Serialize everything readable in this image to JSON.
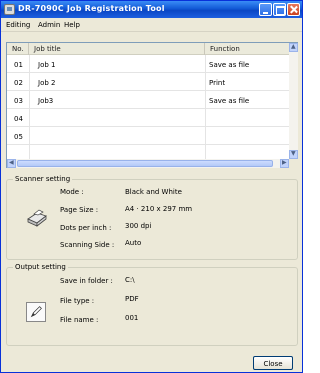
{
  "window": {
    "title": "DR-7090C Job Registration Tool"
  },
  "menu": {
    "items": [
      "Editing",
      "Admin",
      "Help"
    ]
  },
  "list": {
    "columns": [
      "No.",
      "Job title",
      "Function"
    ],
    "rows": [
      {
        "no": "01",
        "title": "Job 1",
        "function": "Save as file"
      },
      {
        "no": "02",
        "title": "Job 2",
        "function": "Print"
      },
      {
        "no": "03",
        "title": "Job3",
        "function": "Save as file"
      },
      {
        "no": "04",
        "title": "",
        "function": ""
      },
      {
        "no": "05",
        "title": "",
        "function": ""
      }
    ]
  },
  "scanner": {
    "group_title": "Scanner setting",
    "mode_label": "Mode :",
    "mode_value": "Black and White",
    "page_size_label": "Page Size :",
    "page_size_value": "A4 · 210 x 297 mm",
    "dpi_label": "Dots per inch :",
    "dpi_value": "300 dpi",
    "side_label": "Scanning Side :",
    "side_value": "Auto"
  },
  "output": {
    "group_title": "Output setting",
    "folder_label": "Save in folder :",
    "folder_value": "C:\\",
    "type_label": "File type :",
    "type_value": "PDF",
    "name_label": "File name :",
    "name_value": "001"
  },
  "buttons": {
    "close": "Close"
  },
  "icons": {
    "app": "app-icon",
    "minimize": "minimize-icon",
    "maximize": "maximize-icon",
    "close": "close-icon",
    "scanner": "scanner-icon",
    "pen": "pen-icon"
  }
}
